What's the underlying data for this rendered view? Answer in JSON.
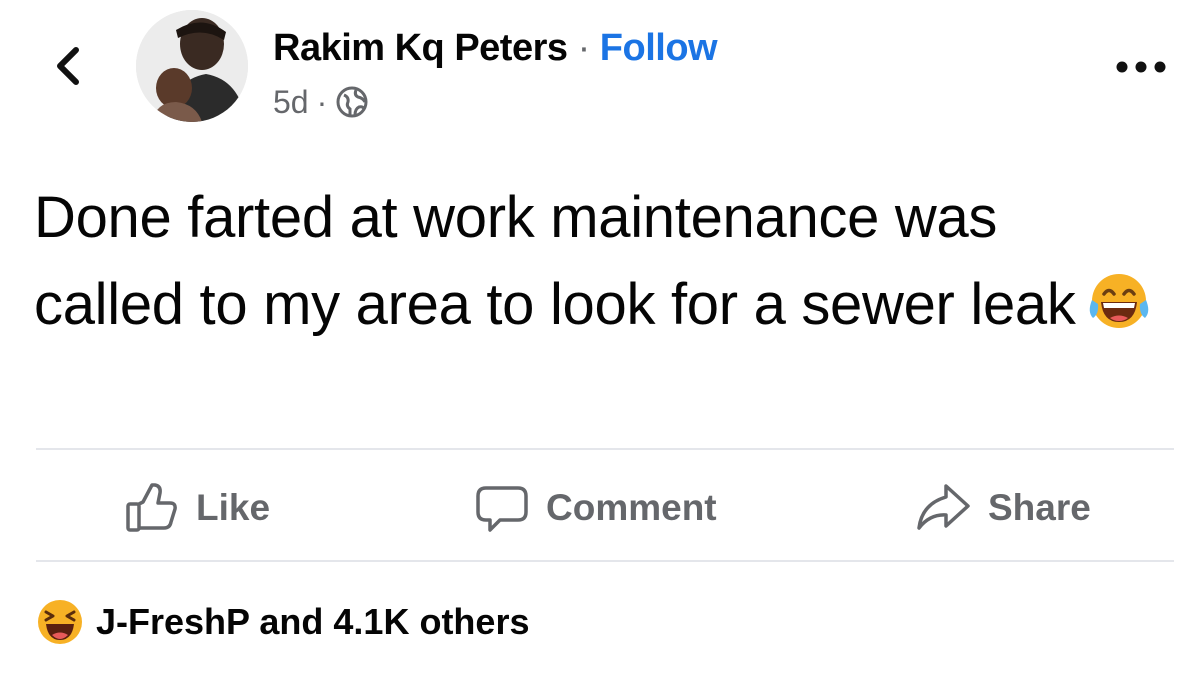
{
  "post": {
    "author": "Rakim Kq Peters",
    "separator": "·",
    "follow_label": "Follow",
    "time": "5d",
    "time_separator": "·",
    "privacy_icon": "globe-icon",
    "text": "Done farted at work maintenance was called to my area to look for a sewer leak",
    "text_emoji": "laughing-tears-emoji"
  },
  "actions": {
    "like_label": "Like",
    "comment_label": "Comment",
    "share_label": "Share"
  },
  "reactions": {
    "summary": "J-FreshP and 4.1K others",
    "icon": "haha-reaction-icon"
  },
  "colors": {
    "link_blue": "#1b74e4",
    "muted_gray": "#65676b",
    "text_black": "#050505",
    "divider": "#e4e6eb",
    "emoji_yellow": "#f7b125"
  }
}
